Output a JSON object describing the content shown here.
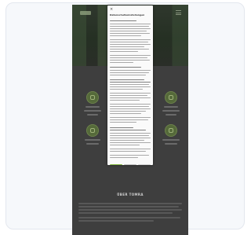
{
  "modal": {
    "close_icon": "×",
    "title": "Datenschutzeinstellungen",
    "subtitle": "",
    "buttons": {
      "accept": "",
      "deny": "",
      "save": ""
    }
  },
  "page": {
    "section_title": "ÜBER TOMRA"
  },
  "colors": {
    "accent": "#7fb53b",
    "overlay": "#3e3e3e",
    "feature_circle": "#556a3a"
  },
  "icons": [
    "close-icon",
    "feature-icon",
    "menu-icon",
    "logo"
  ]
}
